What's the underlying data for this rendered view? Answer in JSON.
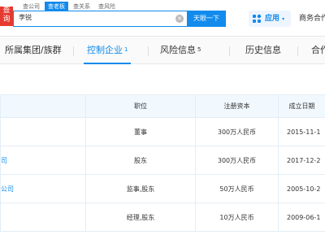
{
  "header": {
    "logo_text": [
      "查",
      "询"
    ],
    "search_tabs": [
      "查公司",
      "查老板",
      "查关系",
      "查风险"
    ],
    "active_search_tab": 1,
    "search_value": "李锐",
    "search_button": "天眼一下",
    "app_button": "应用",
    "biz_link": "商务合作"
  },
  "tabs": [
    {
      "label": "所属集团/族群",
      "count": ""
    },
    {
      "label": "控制企业",
      "count": "1"
    },
    {
      "label": "风险信息",
      "count": "5"
    },
    {
      "label": "历史信息",
      "count": ""
    },
    {
      "label": "合作",
      "count": ""
    }
  ],
  "table": {
    "headers": [
      "",
      "职位",
      "注册资本",
      "成立日期"
    ],
    "rows": [
      {
        "name": "",
        "position": "董事",
        "capital": "300万人民币",
        "date": "2015-11-1"
      },
      {
        "name": "司",
        "position": "股东",
        "capital": "300万人民币",
        "date": "2017-12-2"
      },
      {
        "name": "公司",
        "position": "监事,股东",
        "capital": "50万人民币",
        "date": "2005-10-2"
      },
      {
        "name": "",
        "position": "经理,股东",
        "capital": "10万人民币",
        "date": "2009-06-1"
      }
    ]
  },
  "colors": {
    "accent": "#128bed",
    "logo": "#e63a30",
    "header_bg": "#f2f9fe"
  }
}
